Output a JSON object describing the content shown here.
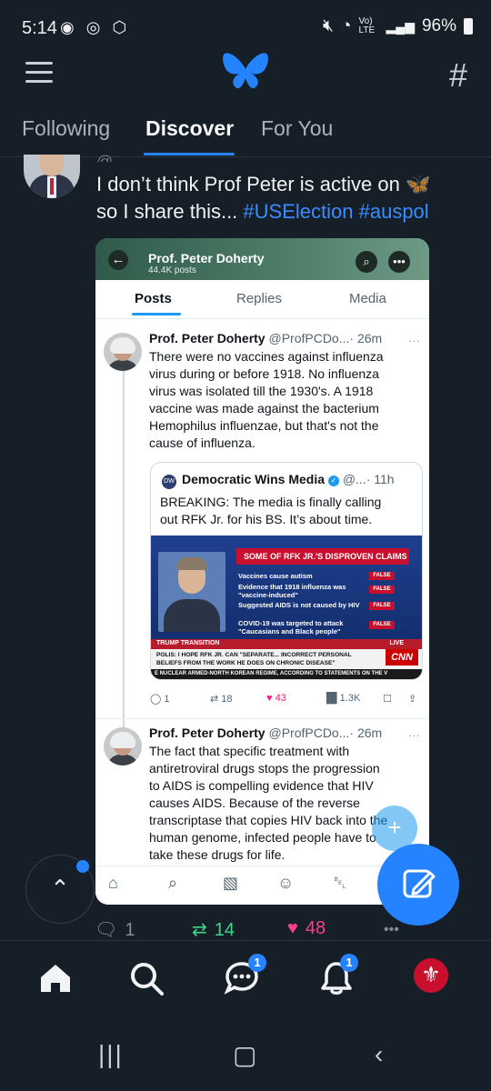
{
  "status_bar": {
    "time": "5:14",
    "left_icons": "◉ ◎ ⬡",
    "network": "Vo) LTE",
    "battery": "96%"
  },
  "header": {
    "tabs": [
      {
        "label": "Following"
      },
      {
        "label": "Discover"
      },
      {
        "label": "For You"
      }
    ],
    "active_tab": "Discover"
  },
  "post": {
    "name_cutoff": "@",
    "text_line1": "I don’t think Prof Peter is active on 🦋",
    "text_line2_plain": "so I share this... ",
    "hashtag1": "#USElection",
    "hashtag2": "#auspol",
    "replies": "1",
    "reposts": "14",
    "likes": "48",
    "more": "•••",
    "accent_repost": "#3dd68c",
    "accent_like": "#ff3d8a"
  },
  "screenshot": {
    "profile_name": "Prof. Peter Doherty",
    "profile_posts": "44.4K posts",
    "tabs": [
      "Posts",
      "Replies",
      "Media"
    ],
    "tweet1": {
      "name": "Prof. Peter Doherty",
      "handle": "@ProfPCDo...",
      "time": "· 26m",
      "lines": [
        "There were no vaccines against influenza",
        "virus during or before 1918. No influenza",
        "virus was isolated till the 1930's. A 1918",
        "vaccine was made against the bacterium",
        "Hemophilus influenzae, but that's not the",
        "cause of influenza."
      ],
      "actions": {
        "replies": "1",
        "reposts": "18",
        "likes": "43",
        "views": "1.3K"
      }
    },
    "quote": {
      "logo": "DW",
      "name": "Democratic Wins Media",
      "handle": "@...",
      "time": "· 11h",
      "lines": [
        "BREAKING: The media is finally calling",
        "out RFK Jr. for his BS. It’s about time."
      ],
      "news": {
        "title": "SOME OF RFK JR.'S DISPROVEN CLAIMS",
        "claims": [
          "Vaccines cause autism",
          "Evidence that 1918 influenza was \"vaccine-induced\"",
          "Suggested AIDS is not caused by HIV",
          "COVID-19 was targeted to attack \"Caucasians and Black people\""
        ],
        "false_label": "FALSE",
        "strip1": "TRUMP TRANSITION",
        "live": "LIVE",
        "strip2": "POLIS: I HOPE RFK JR. CAN \"SEPARATE... INCORRECT PERSONAL BELIEFS FROM THE WORK HE DOES ON CHRONIC DISEASE\"",
        "strip3": "E NUCLEAR ARMED-NORTH KOREAN REGIME, ACCORDING TO STATEMENTS ON THE V",
        "network": "CNN"
      }
    },
    "tweet2": {
      "name": "Prof. Peter Doherty",
      "handle": "@ProfPCDo...",
      "time": "· 26m",
      "lines": [
        "The fact that specific treatment with",
        "antiretroviral drugs stops the progression",
        "to AIDS is compelling evidence that HIV",
        "causes AIDS. Because of the reverse",
        "transcriptase that copies HIV back into the",
        "human genome, infected people have to",
        "take these drugs for life."
      ]
    }
  },
  "nav": {
    "chat_badge": "1",
    "notif_badge": "1"
  },
  "colors": {
    "background": "#161e27",
    "accent": "#2683ff"
  }
}
